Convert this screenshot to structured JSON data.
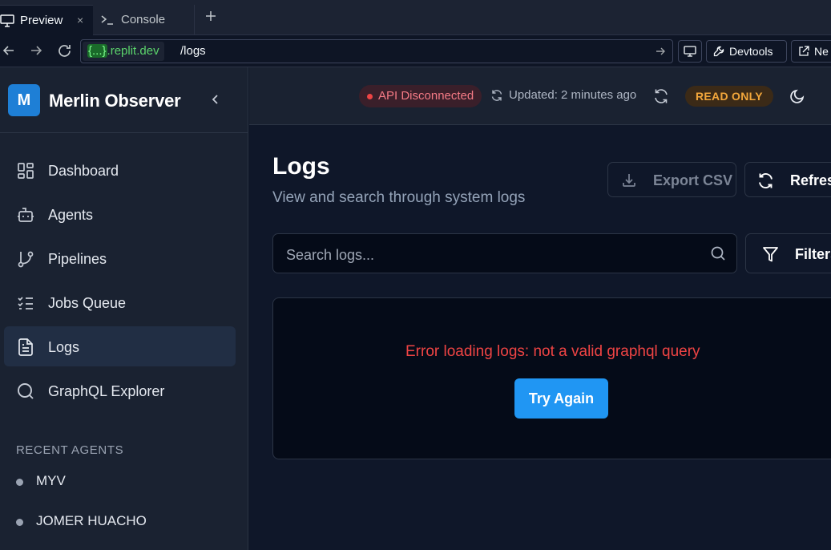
{
  "browser": {
    "tabs": [
      {
        "label": "Preview",
        "close": "×"
      },
      {
        "label": "Console"
      }
    ],
    "new_tab": "+",
    "url": {
      "host_brace": "{...}",
      "host_rest": ".replit.dev",
      "path": "/logs"
    },
    "devtools_label": "Devtools",
    "newtab_label": "Ne"
  },
  "app": {
    "brand": {
      "logo_letter": "M",
      "name": "Merlin Observer"
    },
    "nav": [
      {
        "label": "Dashboard",
        "icon": "dashboard-icon"
      },
      {
        "label": "Agents",
        "icon": "bot-icon"
      },
      {
        "label": "Pipelines",
        "icon": "git-branch-icon"
      },
      {
        "label": "Jobs Queue",
        "icon": "list-checks-icon"
      },
      {
        "label": "Logs",
        "icon": "file-text-icon",
        "active": true
      },
      {
        "label": "GraphQL Explorer",
        "icon": "search-icon"
      }
    ],
    "recent_heading": "RECENT AGENTS",
    "recent_agents": [
      "MYV",
      "JOMER HUACHO"
    ],
    "topbar": {
      "api_status": "API Disconnected",
      "updated": "Updated: 2 minutes ago",
      "mode_badge": "READ ONLY"
    },
    "page": {
      "title": "Logs",
      "subtitle": "View and search through system logs",
      "export_label": "Export CSV",
      "refresh_label": "Refresh",
      "search_placeholder": "Search logs...",
      "filters_label": "Filters",
      "error_message": "Error loading logs: not a valid graphql query",
      "retry_label": "Try Again"
    }
  },
  "colors": {
    "accent": "#2096f3",
    "error": "#ef4444",
    "warning": "#f3a73b",
    "sidebar_bg": "#1a2231",
    "main_bg": "#0f1729"
  }
}
